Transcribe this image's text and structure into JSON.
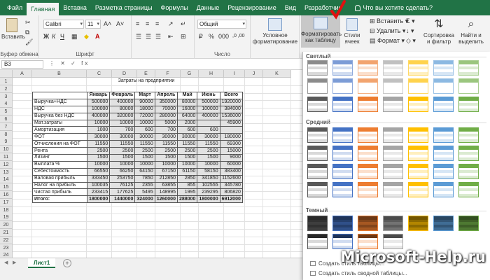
{
  "tabs": [
    "Файл",
    "Главная",
    "Вставка",
    "Разметка страницы",
    "Формулы",
    "Данные",
    "Рецензирование",
    "Вид",
    "Разработчик"
  ],
  "tell_me": "Что вы хотите сделать?",
  "ribbon": {
    "paste_label": "Вставить",
    "clipboard": "Буфер обмена",
    "font_name": "Calibri",
    "font_size": "11",
    "font_group": "Шрифт",
    "number_format": "Общий",
    "number_group": "Число",
    "cond_format": "Условное форматирование",
    "format_table": "Форматировать как таблицу",
    "cell_styles": "Стили ячеек",
    "insert": "Вставить",
    "delete": "Удалить",
    "format": "Формат",
    "sort_filter": "Сортировка и фильтр",
    "find_select": "Найти и выделить"
  },
  "name_box": "B3",
  "sheet": {
    "columns": [
      "A",
      "B",
      "C",
      "D",
      "E",
      "F",
      "G",
      "H",
      "I",
      "J",
      "K"
    ],
    "title": "Затраты на предприятии",
    "headers": [
      "",
      "Январь",
      "Февраль",
      "Март",
      "Апрель",
      "Май",
      "Июнь",
      "Всего"
    ],
    "rows": [
      [
        "Выручка+НДС",
        "500000",
        "400000",
        "90000",
        "350000",
        "80000",
        "500000",
        "1920000"
      ],
      [
        "НДС",
        "100000",
        "80000",
        "18000",
        "70000",
        "16000",
        "100000",
        "384000"
      ],
      [
        "Выручка без НДС",
        "400000",
        "320000",
        "72000",
        "280000",
        "64000",
        "400000",
        "1536000"
      ],
      [
        "Мат.затраты",
        "10000",
        "10000",
        "10000",
        "5000",
        "2000",
        "",
        "45900"
      ],
      [
        "Амортизация",
        "1000",
        "700",
        "600",
        "700",
        "600",
        "600",
        ""
      ],
      [
        "ФОТ",
        "30000",
        "30000",
        "30000",
        "30000",
        "30000",
        "30000",
        "180000"
      ],
      [
        "Отчисления на ФОТ",
        "11550",
        "11550",
        "11550",
        "11550",
        "11550",
        "11550",
        "69300"
      ],
      [
        "Рента",
        "2500",
        "2500",
        "2500",
        "2500",
        "2500",
        "2500",
        "15000"
      ],
      [
        "Лизинг",
        "1500",
        "1500",
        "1500",
        "1500",
        "1500",
        "1500",
        "9000"
      ],
      [
        "Выплата %",
        "10000",
        "10000",
        "10000",
        "10000",
        "10000",
        "10000",
        "60000"
      ],
      [
        "Себестоимость",
        "66550",
        "66250",
        "64150",
        "67150",
        "61150",
        "58150",
        "383400"
      ],
      [
        "Валовая прибыль",
        "333450",
        "253750",
        "7850",
        "212850",
        "2850",
        "341850",
        "1152600"
      ],
      [
        "Налог на прибыль",
        "100035",
        "76125",
        "2355",
        "63855",
        "855",
        "102555",
        "345780"
      ],
      [
        "Чистая прибыль",
        "233415",
        "177625",
        "5495",
        "148995",
        "1995",
        "239295",
        "806820"
      ],
      [
        "Итого:",
        "1800000",
        "1440000",
        "324000",
        "1260000",
        "288000",
        "1800000",
        "6912000"
      ]
    ],
    "row_numbers": [
      "1",
      "2",
      "3",
      "4",
      "5",
      "6",
      "7",
      "8",
      "9",
      "10",
      "11",
      "12",
      "13",
      "14",
      "15",
      "16",
      "17",
      "18",
      "19",
      "20",
      "21",
      "22",
      "23",
      "24"
    ],
    "tab_name": "Лист1"
  },
  "gallery": {
    "light": "Светлый",
    "medium": "Средний",
    "dark": "Темный",
    "new_table_style": "Создать стиль таблицы...",
    "new_pivot_style": "Создать стиль сводной таблицы..."
  },
  "colors": {
    "accent": "#217346",
    "blue": "#4472c4",
    "orange": "#ed7d31",
    "gray": "#a5a5a5",
    "gold": "#ffc000",
    "lightblue": "#5b9bd5",
    "green": "#70ad47"
  },
  "watermark": "Microsoft-Help.ru"
}
